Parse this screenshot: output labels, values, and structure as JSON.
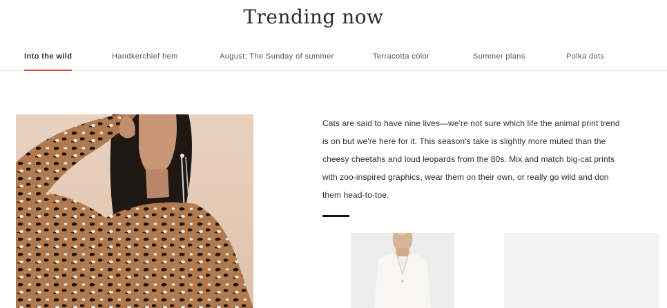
{
  "page": {
    "title": "Trending now"
  },
  "tabs": [
    {
      "label": "Into the wild",
      "active": true
    },
    {
      "label": "Handkerchief hem",
      "active": false
    },
    {
      "label": "August: The Sunday of summer",
      "active": false
    },
    {
      "label": "Terracotta color",
      "active": false
    },
    {
      "label": "Summer plans",
      "active": false
    },
    {
      "label": "Polka dots",
      "active": false
    }
  ],
  "colors": {
    "tab_underline": "#e24040",
    "divider": "#111111"
  },
  "content": {
    "description": "Cats are said to have nine lives—we're not sure which life the animal print trend is on but we're here for it. This season's take is slightly more muted than the cheesy cheetahs and loud leopards from the 80s. Mix and match big-cat prints with zoo-inspired graphics, wear them on their own, or really go wild and don them head-to-toe."
  }
}
